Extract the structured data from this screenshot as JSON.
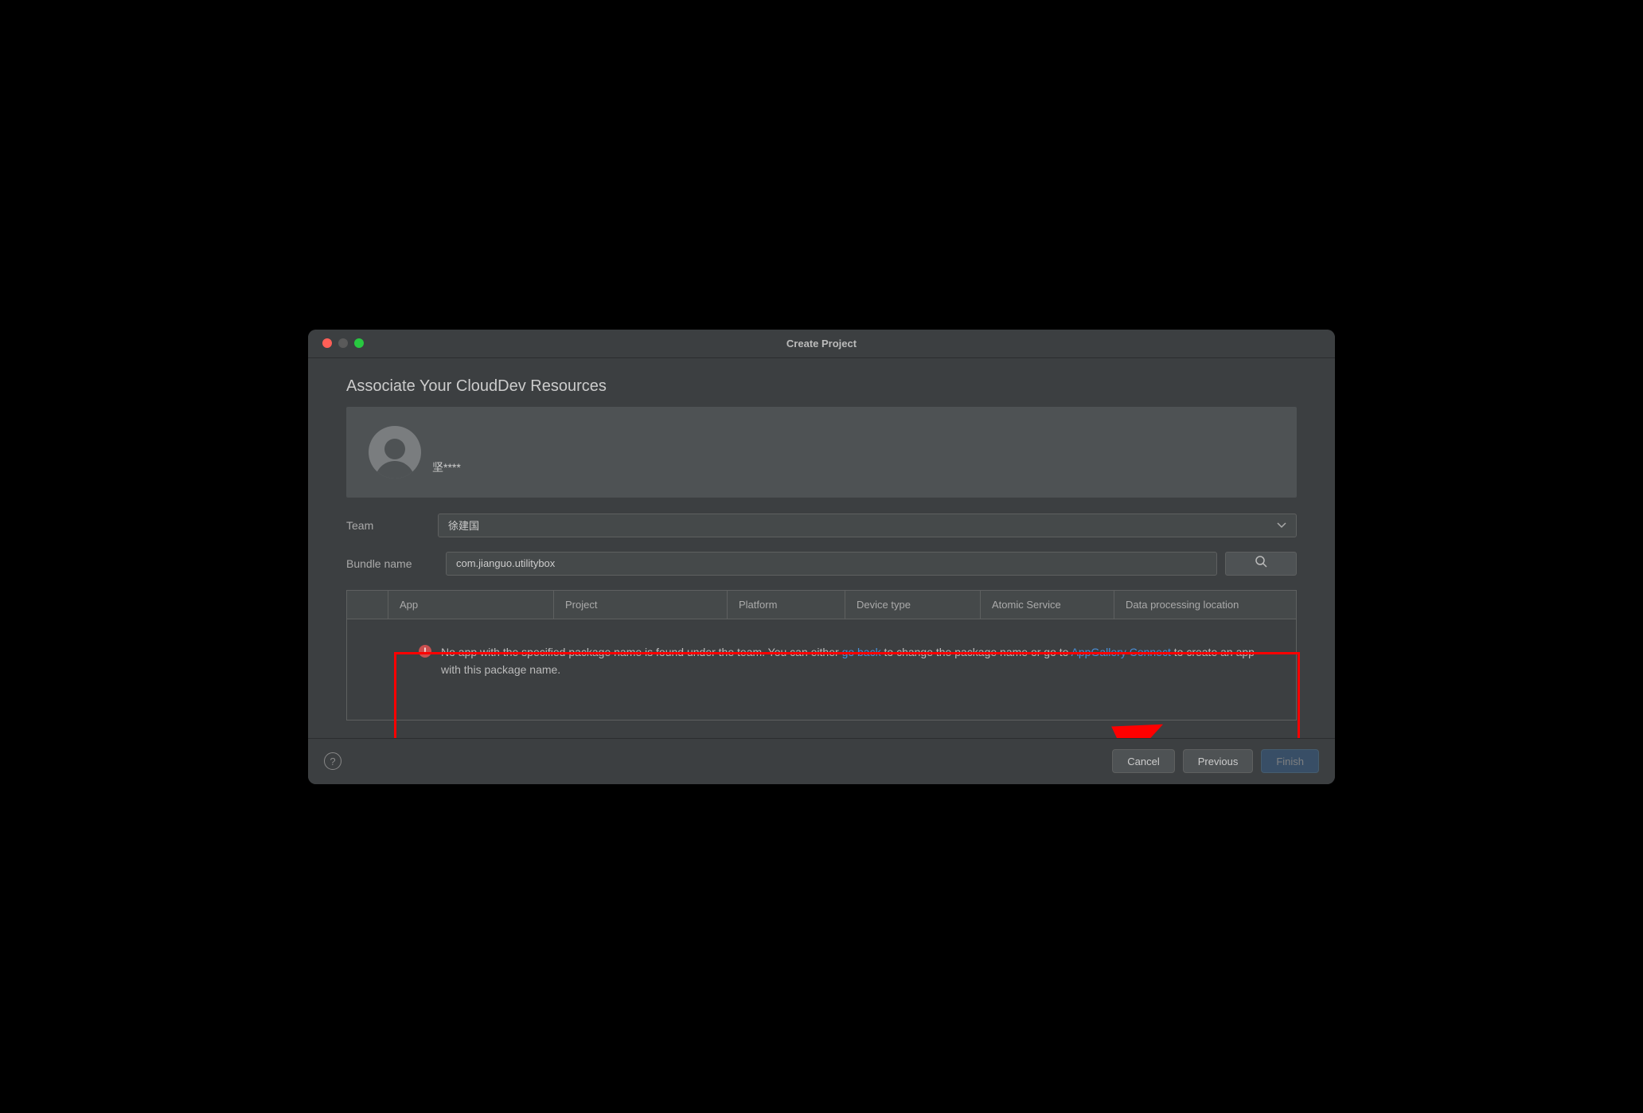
{
  "window": {
    "title": "Create Project"
  },
  "page": {
    "title": "Associate Your CloudDev Resources"
  },
  "user": {
    "name": "坚****"
  },
  "form": {
    "team_label": "Team",
    "team_value": "徐建国",
    "bundle_label": "Bundle name",
    "bundle_value": "com.jianguo.utilitybox"
  },
  "table": {
    "headers": {
      "app": "App",
      "project": "Project",
      "platform": "Platform",
      "device_type": "Device type",
      "atomic_service": "Atomic Service",
      "data_location": "Data processing location"
    },
    "error": {
      "prefix": "No app with the specified package name is found under the team. You can either ",
      "link1": "go back",
      "mid": " to change the package name or go to ",
      "link2": "AppGallery Connect",
      "suffix": " to create an app with this package name."
    }
  },
  "footer": {
    "cancel": "Cancel",
    "previous": "Previous",
    "finish": "Finish"
  }
}
